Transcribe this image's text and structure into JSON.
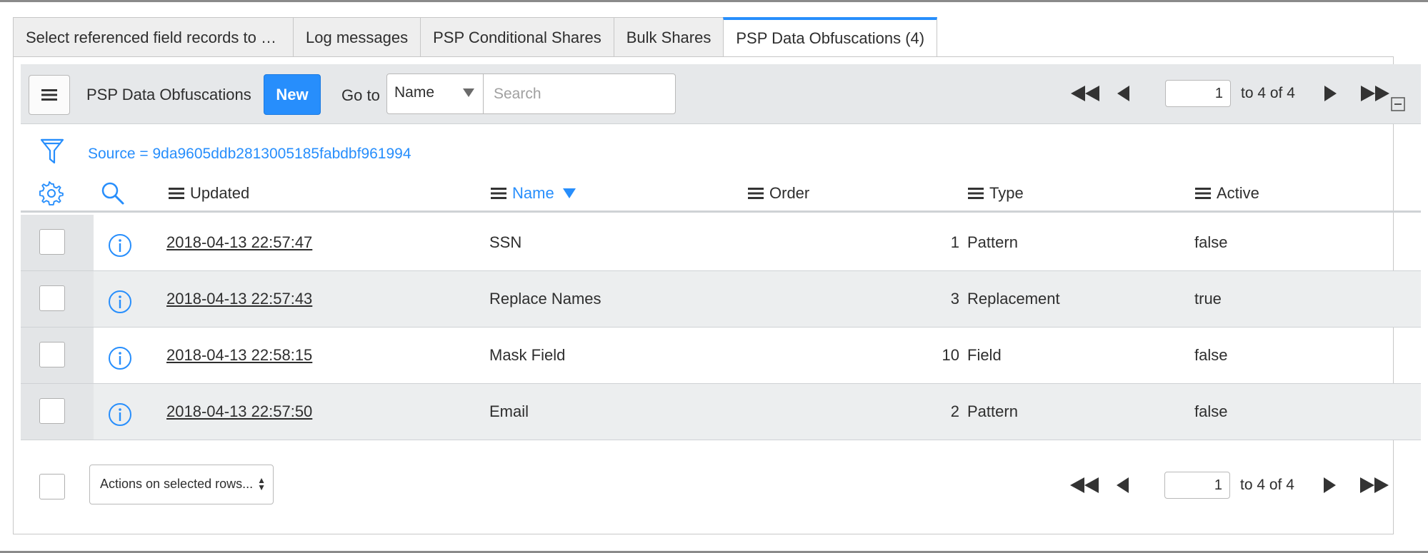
{
  "tabs": [
    {
      "label": "Select referenced field records to …"
    },
    {
      "label": "Log messages"
    },
    {
      "label": "PSP Conditional Shares"
    },
    {
      "label": "Bulk Shares"
    },
    {
      "label": "PSP Data Obfuscations (4)"
    }
  ],
  "toolbar": {
    "title": "PSP Data Obfuscations",
    "new_label": "New",
    "goto_label": "Go to",
    "goto_selected": "Name",
    "search_placeholder": "Search",
    "page_value": "1",
    "page_text": "to 4 of 4"
  },
  "filter": {
    "breadcrumb": "Source = 9da9605ddb2813005185fabdbf961994"
  },
  "columns": [
    {
      "label": "Updated"
    },
    {
      "label": "Name"
    },
    {
      "label": "Order"
    },
    {
      "label": "Type"
    },
    {
      "label": "Active"
    }
  ],
  "rows": [
    {
      "updated": "2018-04-13 22:57:47",
      "name": "SSN",
      "order": "1",
      "type": "Pattern",
      "active": "false"
    },
    {
      "updated": "2018-04-13 22:57:43",
      "name": "Replace Names",
      "order": "3",
      "type": "Replacement",
      "active": "true"
    },
    {
      "updated": "2018-04-13 22:58:15",
      "name": "Mask Field",
      "order": "10",
      "type": "Field",
      "active": "false"
    },
    {
      "updated": "2018-04-13 22:57:50",
      "name": "Email",
      "order": "2",
      "type": "Pattern",
      "active": "false"
    }
  ],
  "footer": {
    "actions_label": "Actions on selected rows...",
    "page_value": "1",
    "page_text": "to 4 of 4"
  },
  "colors": {
    "accent": "#278efc",
    "toolbar_bg": "#e6e8ea",
    "alt_row": "#eceeef"
  },
  "icons": [
    "hamburger-icon",
    "filter-icon",
    "gear-icon",
    "search-icon",
    "column-menu-icon",
    "sort-down-icon",
    "info-icon",
    "first-page-icon",
    "previous-page-icon",
    "next-page-icon",
    "last-page-icon",
    "collapse-icon"
  ]
}
